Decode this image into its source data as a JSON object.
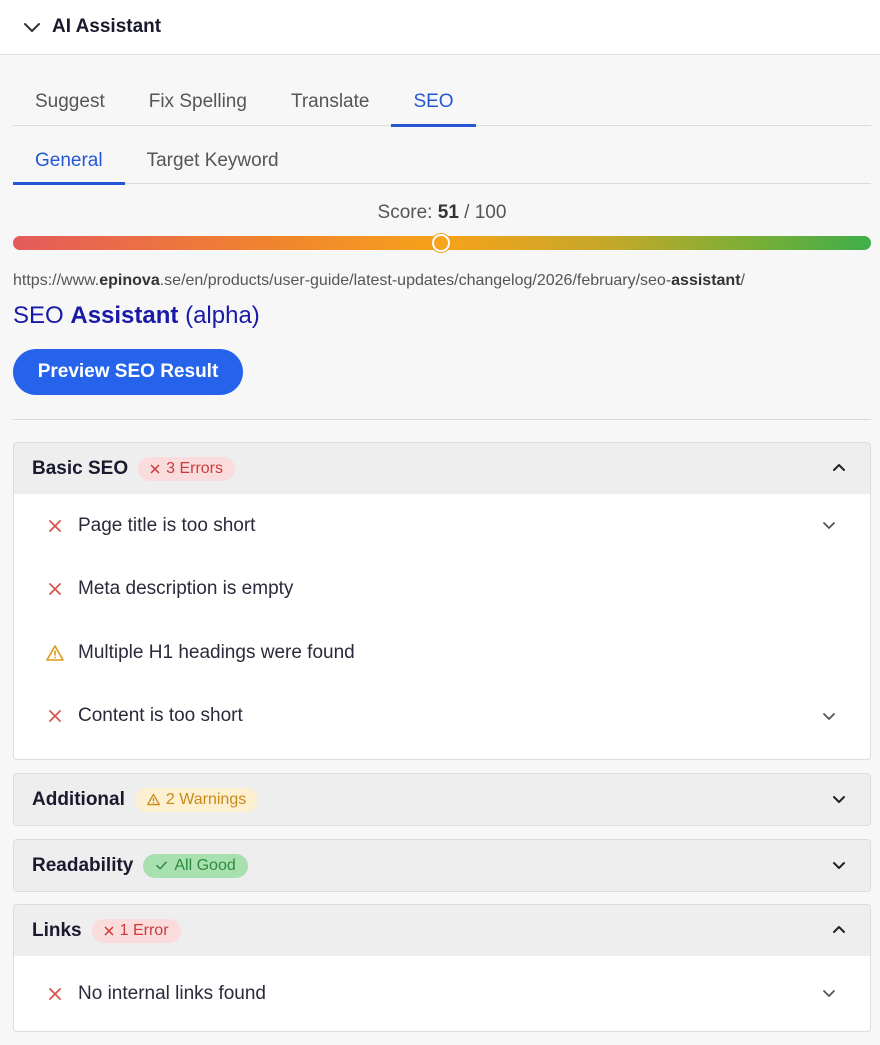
{
  "header": {
    "title": "AI Assistant"
  },
  "tabs": [
    {
      "label": "Suggest",
      "active": false
    },
    {
      "label": "Fix Spelling",
      "active": false
    },
    {
      "label": "Translate",
      "active": false
    },
    {
      "label": "SEO",
      "active": true
    }
  ],
  "subtabs": [
    {
      "label": "General",
      "active": true
    },
    {
      "label": "Target Keyword",
      "active": false
    }
  ],
  "score": {
    "prefix": "Score:",
    "value": "51",
    "separator": "/",
    "max": "100",
    "fraction": 0.51
  },
  "url": {
    "part1": "https://www.",
    "bold1": "epinova",
    "part2": ".se/en/products/user-guide/latest-updates/changelog/2026/february/seo-",
    "bold2": "assistant",
    "part3": "/"
  },
  "seo_title": {
    "part1": "SEO ",
    "bold": "Assistant",
    "part2": " (alpha)"
  },
  "preview_button": {
    "label": "Preview SEO Result"
  },
  "sections": {
    "basic": {
      "title": "Basic SEO",
      "badge": "3 Errors",
      "items": [
        {
          "label": "Page title is too short",
          "status": "error"
        },
        {
          "label": "Meta description is empty",
          "status": "error"
        },
        {
          "label": "Multiple H1 headings were found",
          "status": "warning"
        },
        {
          "label": "Content is too short",
          "status": "error"
        }
      ]
    },
    "additional": {
      "title": "Additional",
      "badge": "2 Warnings"
    },
    "readability": {
      "title": "Readability",
      "badge": "All Good"
    },
    "links": {
      "title": "Links",
      "badge": "1 Error",
      "items": [
        {
          "label": "No internal links found",
          "status": "error"
        }
      ]
    }
  },
  "colors": {
    "accent": "#2456d6",
    "button": "#2563eb",
    "error": "#cc3a3a",
    "warning": "#c98a1a",
    "good": "#2e8a3e"
  }
}
